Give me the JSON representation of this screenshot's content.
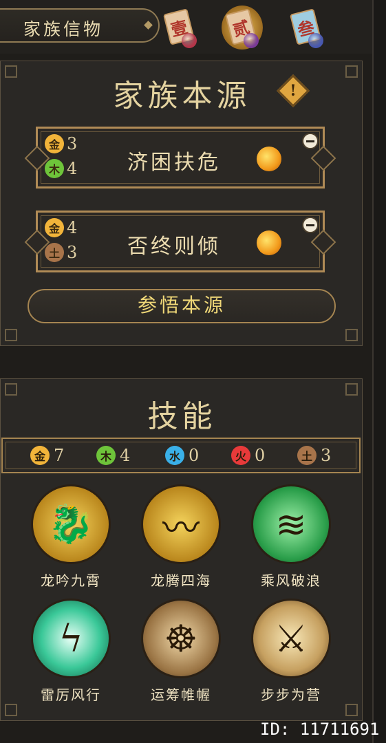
{
  "topbar": {
    "title": "家族信物",
    "tokens": [
      {
        "label": "壹",
        "card_color": "#e6c8a4",
        "text_color": "#b0362c",
        "bead": "#b4364a",
        "active": false
      },
      {
        "label": "贰",
        "card_color": "#e6c8a4",
        "text_color": "#b0362c",
        "bead": "#7a3a96",
        "active": true
      },
      {
        "label": "叁",
        "card_color": "#9fcde0",
        "text_color": "#b0362c",
        "bead": "#4858b0",
        "active": false
      }
    ]
  },
  "origin_panel": {
    "title": "家族本源",
    "warning_glyph": "!",
    "cards": [
      {
        "name": "济困扶危",
        "elements": [
          {
            "glyph": "金",
            "count": "3",
            "color": "#f2b43a"
          },
          {
            "glyph": "木",
            "count": "4",
            "color": "#6ec43a"
          }
        ]
      },
      {
        "name": "否终则倾",
        "elements": [
          {
            "glyph": "金",
            "count": "4",
            "color": "#f2b43a"
          },
          {
            "glyph": "土",
            "count": "3",
            "color": "#a8744a"
          }
        ]
      }
    ],
    "comprehend_button": "参悟本源"
  },
  "skills_panel": {
    "title": "技能",
    "counts": [
      {
        "glyph": "金",
        "count": "7",
        "color": "#f2b43a"
      },
      {
        "glyph": "木",
        "count": "4",
        "color": "#6ec43a"
      },
      {
        "glyph": "水",
        "count": "0",
        "color": "#3ab0e8"
      },
      {
        "glyph": "火",
        "count": "0",
        "color": "#e83a3a"
      },
      {
        "glyph": "土",
        "count": "3",
        "color": "#a8744a"
      }
    ],
    "skills": [
      {
        "name": "龙吟九霄",
        "icon": "dragon-roar-icon",
        "bg": "radial-gradient(circle,#f4d35c,#b9861c 70%,#6b4a10)"
      },
      {
        "name": "龙腾四海",
        "icon": "dragon-soar-icon",
        "bg": "radial-gradient(circle,#f4d35c,#b9861c 70%,#6b4a10)"
      },
      {
        "name": "乘风破浪",
        "icon": "wave-icon",
        "bg": "radial-gradient(circle,#9ef0a8,#2a9e4a 65%,#0e4a22)"
      },
      {
        "name": "雷厉风行",
        "icon": "lightning-icon",
        "bg": "radial-gradient(circle,#e8fff6,#3ac898 55%,#0d5a40)"
      },
      {
        "name": "运筹帷幄",
        "icon": "strategist-icon",
        "bg": "radial-gradient(circle,#f0d8a8,#9a7444 65%,#3e2a16)"
      },
      {
        "name": "步步为营",
        "icon": "swordsman-icon",
        "bg": "radial-gradient(circle,#f8e8b8,#c6a060 60%,#5a3a16)"
      }
    ]
  },
  "watermark": "ID: 11711691"
}
